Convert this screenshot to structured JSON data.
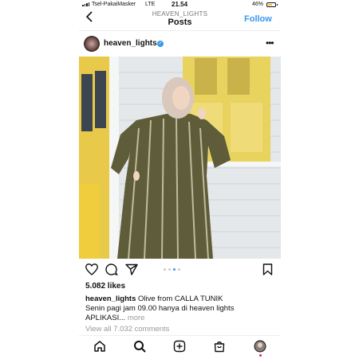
{
  "status_bar": {
    "carrier": "Tsel-PakaiMasker",
    "network": "LTE",
    "time": "21.54",
    "battery": "46%"
  },
  "header": {
    "username": "HEAVEN_LIGHTS",
    "title": "Posts",
    "follow_label": "Follow",
    "back_icon": "chevron-left-icon"
  },
  "post": {
    "username": "heaven_lights",
    "verified_icon": "verified-badge-icon",
    "more_icon": "more-dots-icon",
    "image_alt": "woman in olive patterned tunic dress",
    "carousel": {
      "count": 4,
      "active": 3
    },
    "likes": "5.082 likes",
    "caption_user": "heaven_lights",
    "caption_line1": "Olive  from CALLA TUNIK",
    "caption_line2": "Senin pagi jam 09.00 hanya di heaven lights",
    "caption_line3": "APLIKASI...",
    "more_label": "more",
    "view_comments": "View all 7.032 comments"
  },
  "nav": {
    "items": [
      "home-icon",
      "search-icon",
      "create-icon",
      "shop-icon",
      "profile-icon"
    ]
  },
  "colors": {
    "accent": "#3897f0",
    "dress": "#5f5c3a",
    "door": "#e9d35a"
  }
}
